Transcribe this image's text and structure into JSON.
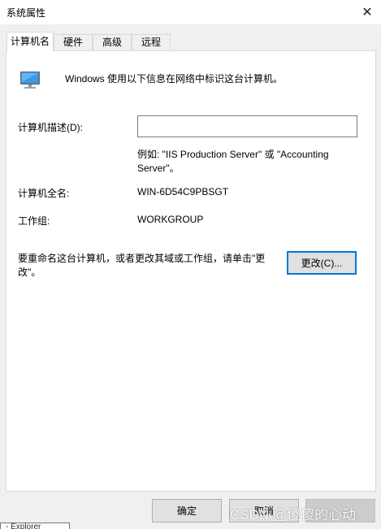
{
  "window": {
    "title": "系统属性",
    "close_icon": "close-icon"
  },
  "tabs": [
    {
      "label": "计算机名",
      "active": true
    },
    {
      "label": "硬件",
      "active": false
    },
    {
      "label": "高级",
      "active": false
    },
    {
      "label": "远程",
      "active": false
    }
  ],
  "computer_name_tab": {
    "icon": "computer-monitor-icon",
    "intro": "Windows 使用以下信息在网络中标识这台计算机。",
    "description_label": "计算机描述(D):",
    "description_value": "",
    "example_line1": "例如: \"IIS Production Server\" 或 \"Accounting",
    "example_line2": "Server\"。",
    "full_name_label": "计算机全名:",
    "full_name_value": "WIN-6D54C9PBSGT",
    "workgroup_label": "工作组:",
    "workgroup_value": "WORKGROUP",
    "rename_text_line1": "要重命名这台计算机，或者更改其域或工作组，请单击\"更",
    "rename_text_line2": "改\"。",
    "change_button": "更改(C)..."
  },
  "footer": {
    "ok_button": "确定",
    "cancel_button": "取消"
  },
  "overlay": {
    "watermark": "CSDN @傻傻的心动",
    "tooltip_fragment": "- Explorer"
  },
  "colors": {
    "accent": "#0078d7",
    "panel_bg": "#ffffff",
    "dialog_bg": "#f0f0f0"
  }
}
